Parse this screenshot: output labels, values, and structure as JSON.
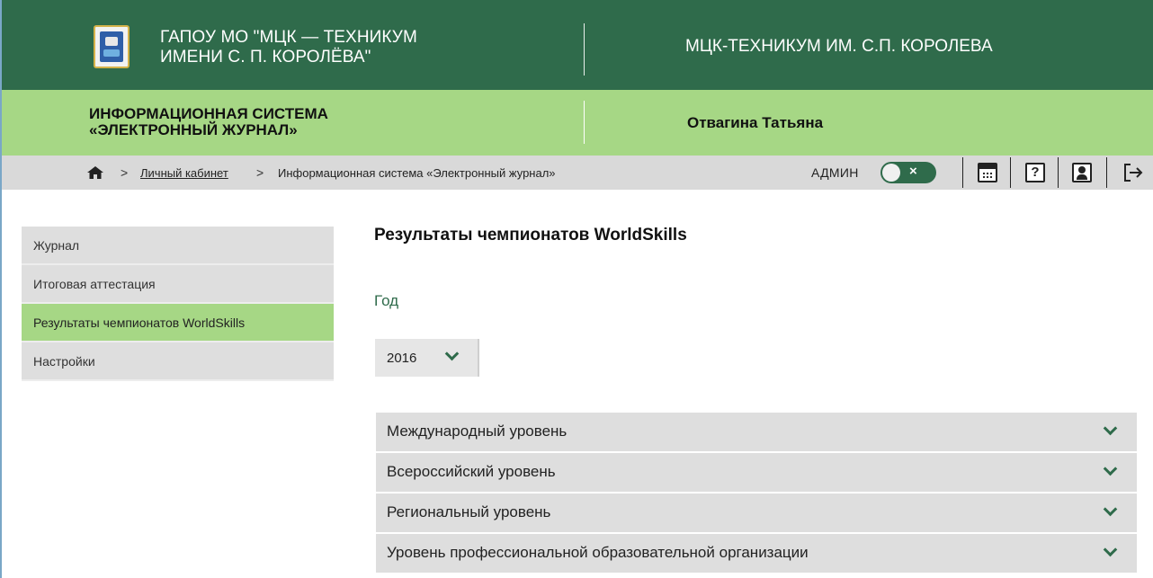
{
  "header": {
    "org_name_line1": "ГАПОУ МО \"МЦК — ТЕХНИКУМ",
    "org_name_line2": "ИМЕНИ С. П. КОРОЛЁВА\"",
    "college_name": "МЦК-ТЕХНИКУМ ИМ. С.П. КОРОЛЕВА",
    "system_name_line1": "ИНФОРМАЦИОННАЯ СИСТЕМА",
    "system_name_line2": "«ЭЛЕКТРОННЫЙ ЖУРНАЛ»",
    "user_name": "Отвагина Татьяна"
  },
  "breadcrumb": {
    "home_icon": "home-icon",
    "separator": ">",
    "items": [
      "Личный кабинет",
      "Информационная система «Электронный журнал»"
    ]
  },
  "toolbar": {
    "admin_label": "АДМИН",
    "admin_toggle_symbol": "×",
    "admin_toggle_on": false,
    "help_symbol": "?",
    "icons": [
      "calendar-icon",
      "help-icon",
      "profile-icon",
      "logout-icon"
    ]
  },
  "sidebar": {
    "items": [
      {
        "label": "Журнал",
        "active": false
      },
      {
        "label": "Итоговая аттестация",
        "active": false
      },
      {
        "label": "Результаты чемпионатов WorldSkills",
        "active": true
      },
      {
        "label": "Настройки",
        "active": false
      }
    ]
  },
  "main": {
    "title": "Результаты чемпионатов WorldSkills",
    "year_label": "Год",
    "year_value": "2016",
    "levels": [
      "Международный уровень",
      "Всероссийский уровень",
      "Региональный уровень",
      "Уровень профессиональной образовательной организации"
    ]
  },
  "colors": {
    "dark_green": "#2f6b4b",
    "light_green": "#a6d785",
    "gray": "#dedede"
  }
}
